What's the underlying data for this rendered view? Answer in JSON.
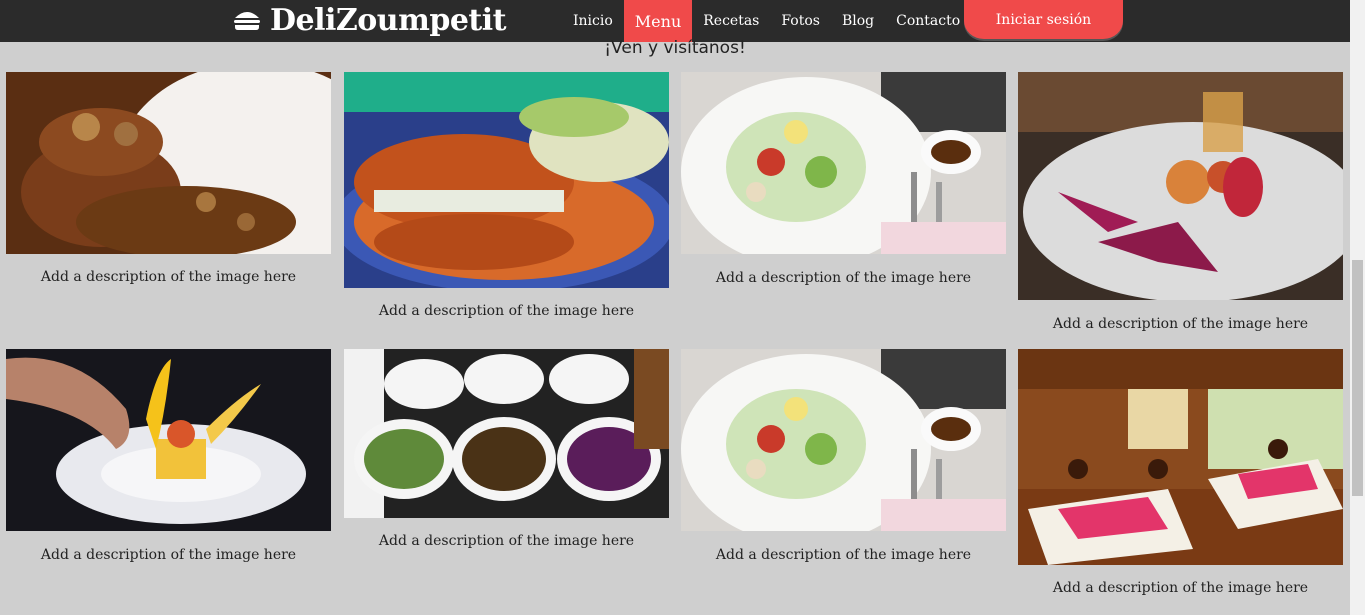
{
  "brand": {
    "name": "DeliZoumpetit",
    "icon": "burger-icon"
  },
  "nav": {
    "items": [
      {
        "label": "Inicio",
        "active": false
      },
      {
        "label": "Menu",
        "active": true
      },
      {
        "label": "Recetas",
        "active": false
      },
      {
        "label": "Fotos",
        "active": false
      },
      {
        "label": "Blog",
        "active": false
      },
      {
        "label": "Contacto",
        "active": false
      }
    ],
    "login_label": "Iniciar sesión"
  },
  "section": {
    "subtitle": "¡Ven y visítanos!"
  },
  "gallery": {
    "items": [
      {
        "image": "steak-with-mushroom-sauce",
        "caption": "Add a description of the image here"
      },
      {
        "image": "fried-sandwich-plate",
        "caption": "Add a description of the image here"
      },
      {
        "image": "salad-plate",
        "caption": "Add a description of the image here"
      },
      {
        "image": "shrimp-plate",
        "caption": "Add a description of the image here"
      },
      {
        "image": "plated-dessert",
        "caption": "Add a description of the image here"
      },
      {
        "image": "salad-buffet",
        "caption": "Add a description of the image here"
      },
      {
        "image": "salad-plate",
        "caption": "Add a description of the image here"
      },
      {
        "image": "restaurant-interior",
        "caption": "Add a description of the image here"
      }
    ]
  },
  "colors": {
    "accent": "#f04a4a",
    "nav_bg": "#2b2b2b",
    "page_bg": "#cfcfcf"
  }
}
